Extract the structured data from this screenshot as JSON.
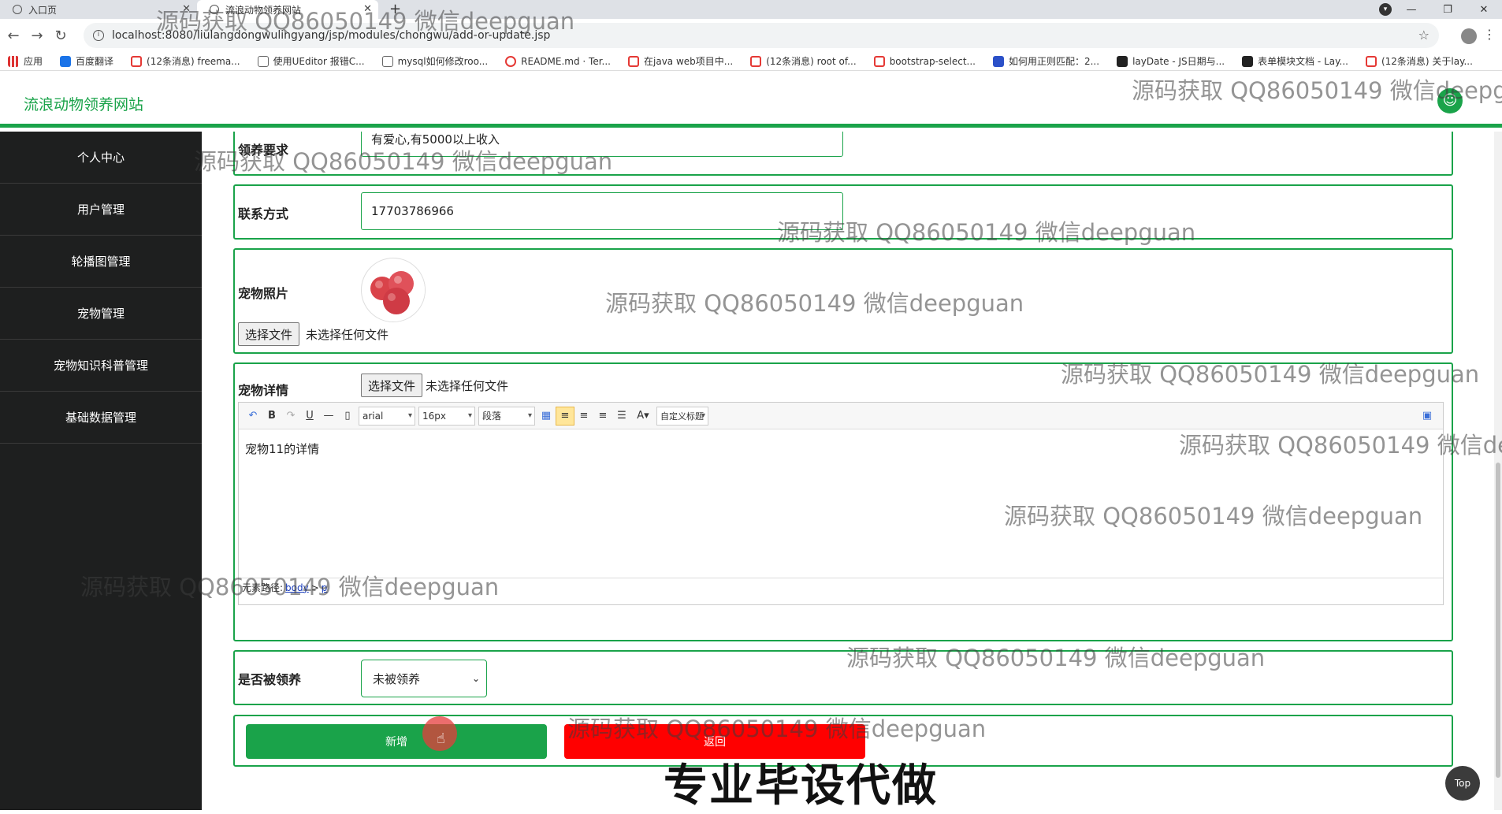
{
  "browser": {
    "tabs": [
      {
        "title": "入口页"
      },
      {
        "title": "流浪动物领养网站"
      }
    ],
    "url": "localhost:8080/liulangdongwulingyang/jsp/modules/chongwu/add-or-update.jsp",
    "bookmarks": [
      {
        "label": "应用",
        "icon": "apps-icon"
      },
      {
        "label": "百度翻译",
        "icon": "baidu-translate-icon"
      },
      {
        "label": "(12条消息) freema...",
        "icon": "csdn-icon"
      },
      {
        "label": "使用UEditor 报错C...",
        "icon": "page-icon"
      },
      {
        "label": "mysql如何修改roo...",
        "icon": "page-icon"
      },
      {
        "label": "README.md · Ter...",
        "icon": "gitee-icon"
      },
      {
        "label": "在java web项目中...",
        "icon": "csdn-icon"
      },
      {
        "label": "(12条消息) root of...",
        "icon": "csdn-icon"
      },
      {
        "label": "bootstrap-select...",
        "icon": "page-icon"
      },
      {
        "label": "如何用正则匹配：2...",
        "icon": "baidu-icon"
      },
      {
        "label": "layDate - JS日期与...",
        "icon": "layui-icon"
      },
      {
        "label": "表单模块文档 - Lay...",
        "icon": "layui-icon"
      },
      {
        "label": "(12条消息) 关于lay...",
        "icon": "csdn-icon"
      }
    ]
  },
  "app": {
    "brand": "流浪动物领养网站",
    "sidebar": [
      {
        "label": "个人中心"
      },
      {
        "label": "用户管理"
      },
      {
        "label": "轮播图管理"
      },
      {
        "label": "宠物管理"
      },
      {
        "label": "宠物知识科普管理"
      },
      {
        "label": "基础数据管理"
      }
    ]
  },
  "form": {
    "requirement": {
      "label": "领养要求",
      "value": "有爱心,有5000以上收入"
    },
    "contact": {
      "label": "联系方式",
      "value": "17703786966"
    },
    "photo": {
      "label": "宠物照片",
      "file_button": "选择文件",
      "file_status": "未选择任何文件"
    },
    "detail": {
      "label": "宠物详情",
      "file_button": "选择文件",
      "file_status": "未选择任何文件",
      "toolbar": {
        "font_family": "arial",
        "font_size": "16px",
        "paragraph": "段落",
        "custom_title": "自定义标题"
      },
      "content": "宠物11的详情",
      "status_label": "元素路径:",
      "status_path": [
        "body",
        "p"
      ]
    },
    "adopted": {
      "label": "是否被领养",
      "value": "未被领养"
    },
    "buttons": {
      "save": "新增",
      "back": "返回"
    }
  },
  "top_button": "Top",
  "watermark": "源码获取 QQ86050149 微信deepguan",
  "banner": "专业毕设代做",
  "colors": {
    "accent": "#1aa34a",
    "danger": "#ff0000",
    "sidebar_bg": "#1e1f1f"
  }
}
